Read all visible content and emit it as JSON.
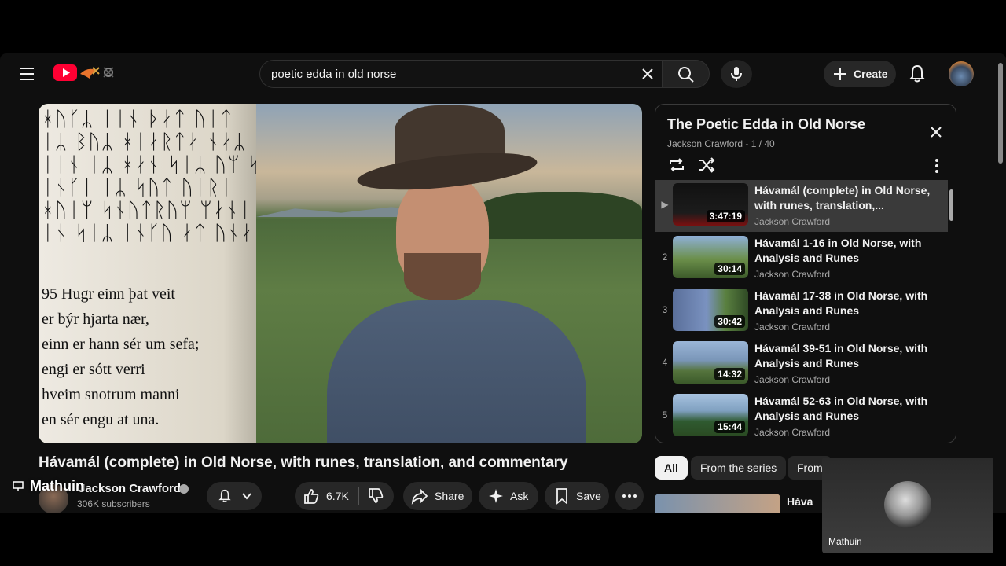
{
  "search": {
    "query": "poetic edda in old norse"
  },
  "header": {
    "create_label": "Create"
  },
  "player": {
    "runes": "ᚼᚢᚴᛦ ᛁᛁᚾ ᚦᛅᛏ ᚢᛁᛏ\nᛁᛦ ᛒᚢᛦ ᚼᛁᛅᚱᛏᛅ ᚾᛅᛦ\nᛁᛁᚾ ᛁᛦ ᚼᛅᚾ ᛋᛁᛦ ᚢᛘ ᛋᛁᚠᛅ\nᛁᚾᚴᛁ ᛁᛦ ᛋᚢᛏ ᚢᛁᚱᛁ\nᚼᚢᛁᛘ ᛋᚾᚢᛏᚱᚢᛘ ᛘᛅᚾᛁ\nᛁᚾ ᛋᛁᛦ ᛁᚾᚴᚢ ᛅᛏ ᚢᚾᛅ",
    "verse_lines": [
      "95 Hugr einn þat veit",
      "er býr hjarta nær,",
      "einn er hann sér um sefa;",
      "engi er sótt verri",
      "hveim snotrum manni",
      "en sér engu at una."
    ]
  },
  "video": {
    "title": "Hávamál (complete) in Old Norse, with runes, translation, and commentary",
    "channel": "Jackson Crawford",
    "subscribers": "306K subscribers",
    "likes": "6.7K",
    "share_label": "Share",
    "ask_label": "Ask",
    "save_label": "Save"
  },
  "cast_overlay": {
    "name": "Mathuin"
  },
  "playlist": {
    "title": "The Poetic Edda in Old Norse",
    "subtitle": "Jackson Crawford - 1 / 40",
    "items": [
      {
        "index": "▶",
        "title": "Hávamál (complete) in Old Norse, with runes, translation,...",
        "channel": "Jackson Crawford",
        "duration": "3:47:19",
        "active": true
      },
      {
        "index": "2",
        "title": "Hávamál 1-16 in Old Norse, with Analysis and Runes",
        "channel": "Jackson Crawford",
        "duration": "30:14"
      },
      {
        "index": "3",
        "title": "Hávamál 17-38 in Old Norse, with Analysis and Runes",
        "channel": "Jackson Crawford",
        "duration": "30:42"
      },
      {
        "index": "4",
        "title": "Hávamál 39-51 in Old Norse, with Analysis and Runes",
        "channel": "Jackson Crawford",
        "duration": "14:32"
      },
      {
        "index": "5",
        "title": "Hávamál 52-63 in Old Norse, with Analysis and Runes",
        "channel": "Jackson Crawford",
        "duration": "15:44"
      }
    ]
  },
  "chips": [
    "All",
    "From the series",
    "From"
  ],
  "recommendation": {
    "title": "Háva"
  },
  "call_tile": {
    "name": "Mathuin"
  },
  "colors": {
    "background": "#0f0f0f",
    "pill": "#272727",
    "brand_red": "#ff0033"
  }
}
